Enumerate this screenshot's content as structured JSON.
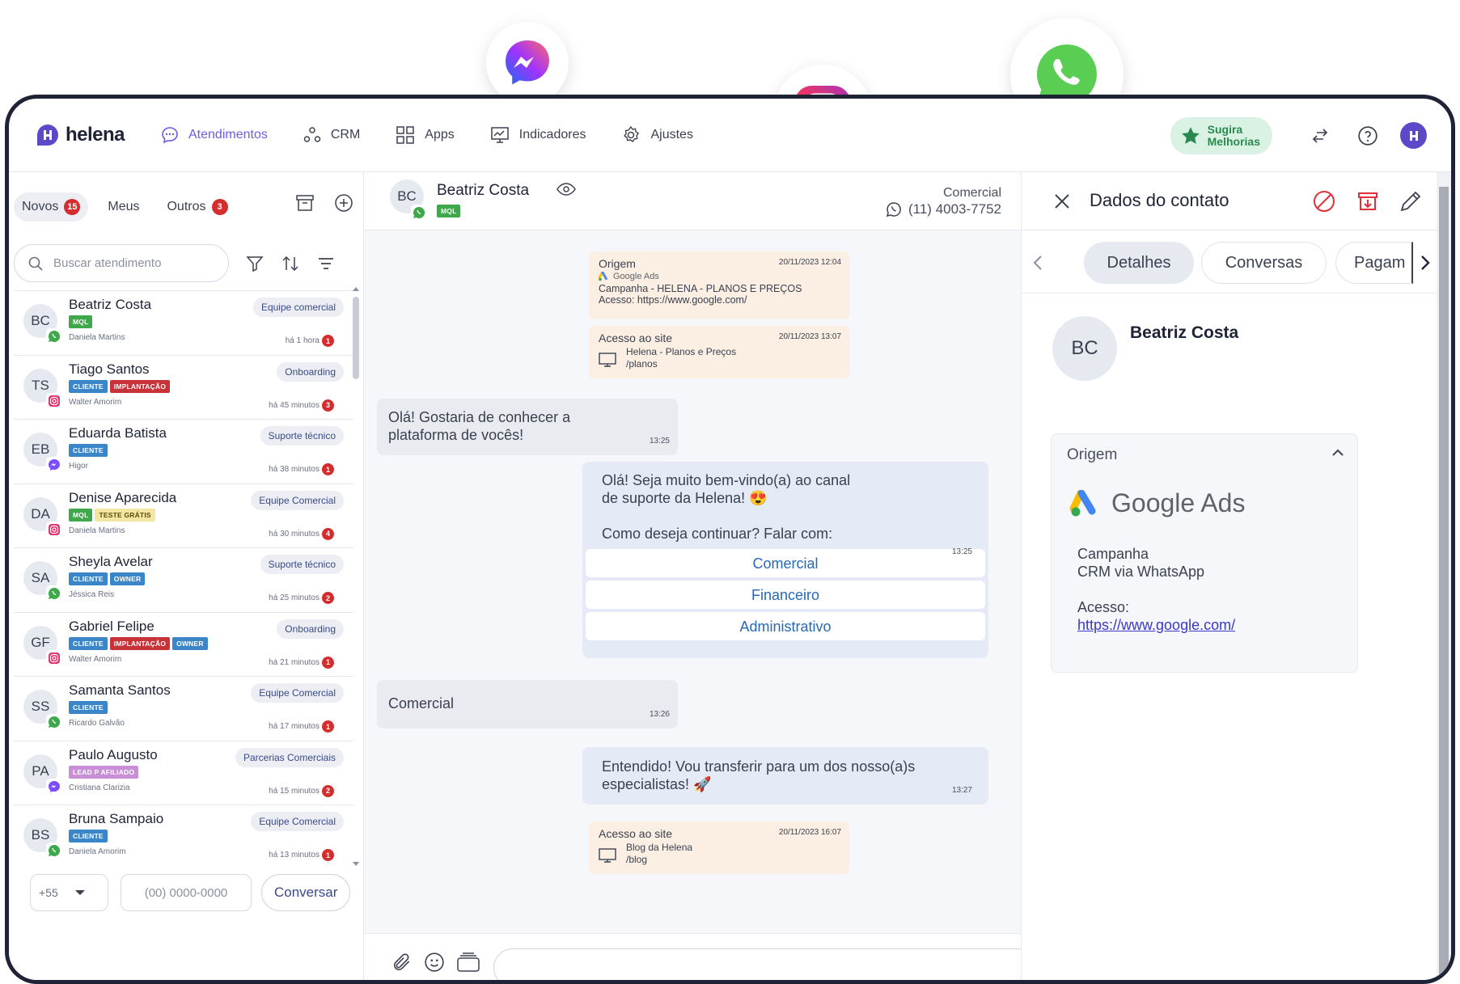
{
  "brand": {
    "name": "helena",
    "accent": "#6b5ce0",
    "navy": "#1e2336",
    "red": "#d32d2d",
    "green": "#2a8a4e"
  },
  "floating_icons": [
    "messenger-icon",
    "instagram-icon",
    "whatsapp-icon"
  ],
  "nav": {
    "items": [
      {
        "label": "Atendimentos",
        "icon": "chat-bubble-icon",
        "active": true
      },
      {
        "label": "CRM",
        "icon": "crm-nodes-icon"
      },
      {
        "label": "Apps",
        "icon": "apps-grid-icon"
      },
      {
        "label": "Indicadores",
        "icon": "presentation-chart-icon"
      },
      {
        "label": "Ajustes",
        "icon": "gear-icon"
      }
    ],
    "suggest_line1": "Sugira",
    "suggest_line2": "Melhorias"
  },
  "inbox": {
    "tabs": [
      {
        "label": "Novos",
        "badge": "15"
      },
      {
        "label": "Meus"
      },
      {
        "label": "Outros",
        "badge": "3"
      }
    ],
    "search_placeholder": "Buscar atendimento",
    "items": [
      {
        "initials": "BC",
        "name": "Beatriz Costa",
        "channel": "whatsapp",
        "tags": [
          {
            "text": "MQL",
            "color": "#3ea84a"
          }
        ],
        "agent": "Daniela Martins",
        "team": "Equipe comercial",
        "time": "há 1 hora",
        "count": "1"
      },
      {
        "initials": "TS",
        "name": "Tiago Santos",
        "channel": "instagram",
        "tags": [
          {
            "text": "CLIENTE",
            "color": "#3a86c8"
          },
          {
            "text": "IMPLANTAÇÃO",
            "color": "#c8333a"
          }
        ],
        "agent": "Walter Amorim",
        "team": "Onboarding",
        "time": "há 45 minutos",
        "count": "3"
      },
      {
        "initials": "EB",
        "name": "Eduarda Batista",
        "channel": "messenger",
        "tags": [
          {
            "text": "CLIENTE",
            "color": "#3a86c8"
          }
        ],
        "agent": "Higor",
        "team": "Suporte técnico",
        "time": "há 38 minutos",
        "count": "1"
      },
      {
        "initials": "DA",
        "name": "Denise Aparecida",
        "channel": "instagram",
        "tags": [
          {
            "text": "MQL",
            "color": "#3ea84a"
          },
          {
            "text": "TESTE GRÁTIS",
            "color": "#f3e6a0",
            "dark": true
          }
        ],
        "agent": "Daniela Martins",
        "team": "Equipe Comercial",
        "time": "há 30 minutos",
        "count": "4"
      },
      {
        "initials": "SA",
        "name": "Sheyla Avelar",
        "channel": "whatsapp",
        "tags": [
          {
            "text": "CLIENTE",
            "color": "#3a86c8"
          },
          {
            "text": "OWNER",
            "color": "#3a86c8"
          }
        ],
        "agent": "Jéssica Reis",
        "team": "Suporte técnico",
        "time": "há 25 minutos",
        "count": "2"
      },
      {
        "initials": "GF",
        "name": "Gabriel Felipe",
        "channel": "instagram",
        "tags": [
          {
            "text": "CLIENTE",
            "color": "#3a86c8"
          },
          {
            "text": "IMPLANTAÇÃO",
            "color": "#c8333a"
          },
          {
            "text": "OWNER",
            "color": "#3a86c8"
          }
        ],
        "agent": "Walter Amorim",
        "team": "Onboarding",
        "time": "há 21 minutos",
        "count": "1"
      },
      {
        "initials": "SS",
        "name": "Samanta Santos",
        "channel": "whatsapp",
        "tags": [
          {
            "text": "CLIENTE",
            "color": "#3a86c8"
          }
        ],
        "agent": "Ricardo Galvão",
        "team": "Equipe Comercial",
        "time": "há 17 minutos",
        "count": "1"
      },
      {
        "initials": "PA",
        "name": "Paulo Augusto",
        "channel": "messenger",
        "tags": [
          {
            "text": "LEAD P AFILIADO",
            "color": "#c98fd6"
          }
        ],
        "agent": "Cristiana Clarizia",
        "team": "Parcerias Comerciais",
        "time": "há 15 minutos",
        "count": "2"
      },
      {
        "initials": "BS",
        "name": "Bruna Sampaio",
        "channel": "whatsapp",
        "tags": [
          {
            "text": "CLIENTE",
            "color": "#3a86c8"
          }
        ],
        "agent": "Daniela Amorim",
        "team": "Equipe Comercial",
        "time": "há 13 minutos",
        "count": "1"
      }
    ],
    "ddi": "+55",
    "phone_placeholder": "(00) 0000-0000",
    "start_button": "Conversar"
  },
  "chat": {
    "contact": {
      "initials": "BC",
      "name": "Beatriz Costa",
      "tag": "MQL"
    },
    "department": "Comercial",
    "phone": "(11) 4003-7752",
    "origin_card": {
      "title": "Origem",
      "date": "20/11/2023 12:04",
      "source": "Google Ads",
      "line1": "Campanha - HELENA - PLANOS E PREÇOS",
      "line2": "Acesso: https://www.google.com/"
    },
    "visit1": {
      "title": "Acesso ao site",
      "date": "20/11/2023 13:07",
      "line1": "Helena - Planos e Preços",
      "line2": "/planos"
    },
    "msg1": {
      "line1": "Olá! Gostaria de conhecer a",
      "line2": "plataforma de vocês!",
      "time": "13:25"
    },
    "msg2": {
      "line1": "Olá! Seja muito bem-vindo(a) ao canal",
      "line2": "de suporte da Helena! 😍",
      "line3": "Como deseja continuar? Falar com:",
      "time": "13:25",
      "options": [
        "Comercial",
        "Financeiro",
        "Administrativo"
      ]
    },
    "msg3": {
      "text": "Comercial",
      "time": "13:26"
    },
    "msg4": {
      "line1": "Entendido! Vou transferir para um dos nosso(a)s",
      "line2": "especialistas! 🚀",
      "time": "13:27"
    },
    "visit2": {
      "title": "Acesso ao site",
      "date": "20/11/2023 16:07",
      "line1": "Blog da Helena",
      "line2": "/blog"
    }
  },
  "contact_panel": {
    "title": "Dados do contato",
    "tabs": [
      "Detalhes",
      "Conversas",
      "Pagam"
    ],
    "initials": "BC",
    "name": "Beatriz Costa",
    "origin_label": "Origem",
    "source": "Google Ads",
    "campaign_label": "Campanha",
    "campaign": "CRM via WhatsApp",
    "access_label": "Acesso:",
    "access_url": "https://www.google.com/"
  }
}
